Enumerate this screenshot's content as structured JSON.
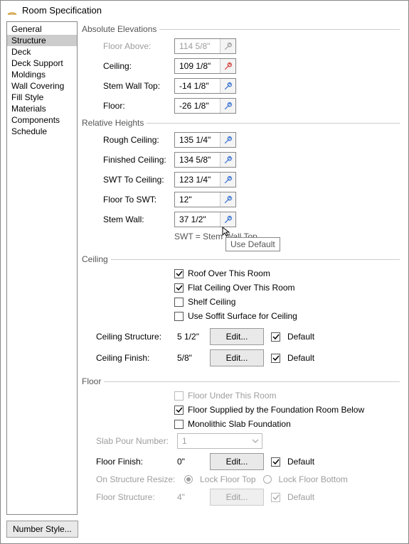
{
  "window": {
    "title": "Room Specification"
  },
  "sidebar": {
    "items": [
      {
        "label": "General"
      },
      {
        "label": "Structure",
        "selected": true
      },
      {
        "label": "Deck"
      },
      {
        "label": "Deck Support"
      },
      {
        "label": "Moldings"
      },
      {
        "label": "Wall Covering"
      },
      {
        "label": "Fill Style"
      },
      {
        "label": "Materials"
      },
      {
        "label": "Components"
      },
      {
        "label": "Schedule"
      }
    ]
  },
  "sections": {
    "absolute": {
      "title": "Absolute Elevations",
      "rows": [
        {
          "label": "Floor Above:",
          "value": "114 5/8\"",
          "disabled": true,
          "wrench": "gray"
        },
        {
          "label": "Ceiling:",
          "value": "109 1/8\"",
          "wrench": "red"
        },
        {
          "label": "Stem Wall Top:",
          "value": "-14 1/8\"",
          "wrench": "blue"
        },
        {
          "label": "Floor:",
          "value": "-26 1/8\"",
          "wrench": "blue"
        }
      ]
    },
    "relative": {
      "title": "Relative Heights",
      "rows": [
        {
          "label": "Rough Ceiling:",
          "value": "135 1/4\"",
          "wrench": "blue"
        },
        {
          "label": "Finished Ceiling:",
          "value": "134 5/8\"",
          "wrench": "blue"
        },
        {
          "label": "SWT To Ceiling:",
          "value": "123 1/4\"",
          "wrench": "blue"
        },
        {
          "label": "Floor To SWT:",
          "value": "12\"",
          "wrench": "blue"
        },
        {
          "label": "Stem Wall:",
          "value": "37 1/2\"",
          "wrench": "blue"
        }
      ],
      "note": "SWT = Stem Wall Top",
      "tooltip": "Use Default"
    },
    "ceiling": {
      "title": "Ceiling",
      "checks": [
        {
          "label": "Roof Over This Room",
          "checked": true
        },
        {
          "label": "Flat Ceiling Over This Room",
          "checked": true
        },
        {
          "label": "Shelf Ceiling",
          "checked": false
        },
        {
          "label": "Use Soffit Surface for Ceiling",
          "checked": false
        }
      ],
      "structure": {
        "label": "Ceiling Structure:",
        "value": "5 1/2\"",
        "edit": "Edit...",
        "default_checked": true,
        "default_label": "Default"
      },
      "finish": {
        "label": "Ceiling Finish:",
        "value": "5/8\"",
        "edit": "Edit...",
        "default_checked": true,
        "default_label": "Default"
      }
    },
    "floor": {
      "title": "Floor",
      "checks": [
        {
          "label": "Floor Under This Room",
          "checked": false,
          "disabled": true
        },
        {
          "label": "Floor Supplied by the Foundation Room Below",
          "checked": true
        },
        {
          "label": "Monolithic Slab Foundation",
          "checked": false
        }
      ],
      "slab": {
        "label": "Slab Pour Number:",
        "value": "1"
      },
      "finish": {
        "label": "Floor Finish:",
        "value": "0\"",
        "edit": "Edit...",
        "default_checked": true,
        "default_label": "Default"
      },
      "resize": {
        "label": "On Structure Resize:",
        "opt1": "Lock Floor Top",
        "opt2": "Lock Floor Bottom"
      },
      "structure": {
        "label": "Floor Structure:",
        "value": "4\"",
        "edit": "Edit...",
        "default_checked": true,
        "default_label": "Default"
      }
    }
  },
  "footer": {
    "number_style": "Number Style..."
  }
}
